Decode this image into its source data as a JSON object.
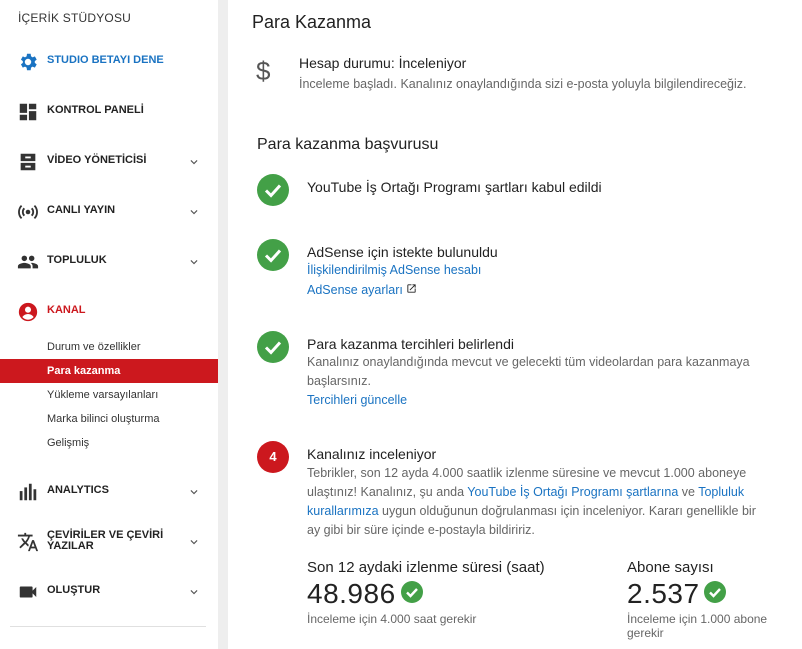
{
  "sidebar": {
    "title": "İÇERİK STÜDYOSU",
    "beta": "STUDIO BETAYI DENE",
    "items": [
      {
        "label": "KONTROL PANELİ"
      },
      {
        "label": "VİDEO YÖNETİCİSİ"
      },
      {
        "label": "CANLI YAYIN"
      },
      {
        "label": "TOPLULUK"
      },
      {
        "label": "KANAL"
      },
      {
        "label": "ANALYTICS"
      },
      {
        "label1": "ÇEVİRİLER VE ÇEVİRİ",
        "label2": "YAZILAR"
      },
      {
        "label": "OLUŞTUR"
      }
    ],
    "channel_sub": [
      {
        "label": "Durum ve özellikler"
      },
      {
        "label": "Para kazanma"
      },
      {
        "label": "Yükleme varsayılanları"
      },
      {
        "label": "Marka bilinci oluşturma"
      },
      {
        "label": "Gelişmiş"
      }
    ],
    "colors": {
      "accent": "#cc181e",
      "beta_blue": "#1a73c2"
    }
  },
  "main": {
    "title": "Para Kazanma",
    "account_icon": "dollar-icon",
    "account_status": "Hesap durumu: İnceleniyor",
    "account_desc": "İnceleme başladı. Kanalınız onaylandığında sizi e-posta yoluyla bilgilendireceğiz.",
    "section_title": "Para kazanma başvurusu",
    "steps": [
      {
        "title": "YouTube İş Ortağı Programı şartları kabul edildi"
      },
      {
        "title": "AdSense için istekte bulunuldu",
        "link1": "İlişkilendirilmiş AdSense hesabı",
        "link2": "AdSense ayarları"
      },
      {
        "title": "Para kazanma tercihleri belirlendi",
        "line1": "Kanalınız onaylandığında mevcut ve gelecekti tüm videolardan para kazanmaya",
        "line2": "başlarsınız.",
        "link": "Tercihleri güncelle"
      },
      {
        "number": "4",
        "title": "Kanalınız inceleniyor",
        "line1": "Tebrikler, son 12 ayda 4.000 saatlik izlenme süresine ve mevcut 1.000 aboneye",
        "line2_a": "ulaştınız! Kanalınız, şu anda ",
        "line2_link1": "YouTube İş Ortağı Programı şartlarına",
        "line2_b": " ve ",
        "line2_link2": "Topluluk",
        "line3_link": "kurallarımıza",
        "line3_b": " uygun olduğunun doğrulanması için inceleniyor. Kararı genellikle bir",
        "line4": "ay gibi bir süre içinde e-postayla bildiririz."
      }
    ],
    "stats": [
      {
        "label": "Son 12 aydaki izlenme süresi (saat)",
        "value": "48.986",
        "note": "İnceleme için 4.000 saat gerekir"
      },
      {
        "label": "Abone sayısı",
        "value": "2.537",
        "note1": "İnceleme için 1.000 abone",
        "note2": "gerekir"
      }
    ],
    "colors": {
      "success": "#43a047",
      "link": "#1a73c2"
    }
  }
}
